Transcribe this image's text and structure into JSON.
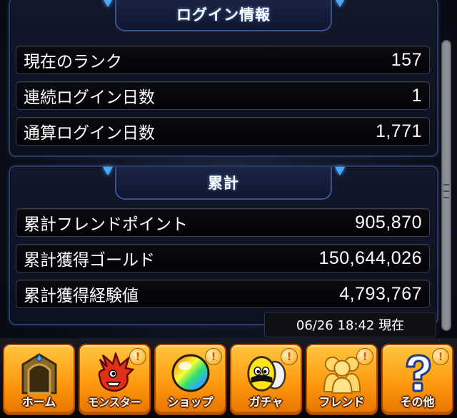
{
  "login_section": {
    "title": "ログイン情報",
    "rows": [
      {
        "label": "現在のランク",
        "value": "157"
      },
      {
        "label": "連続ログイン日数",
        "value": "1"
      },
      {
        "label": "通算ログイン日数",
        "value": "1,771"
      }
    ]
  },
  "total_section": {
    "title": "累計",
    "rows": [
      {
        "label": "累計フレンドポイント",
        "value": "905,870"
      },
      {
        "label": "累計獲得ゴールド",
        "value": "150,644,026"
      },
      {
        "label": "累計獲得経験値",
        "value": "4,793,767"
      }
    ]
  },
  "timestamp": "06/26 18:42 現在",
  "navbar": {
    "items": [
      {
        "label": "ホーム",
        "icon": "gate-icon"
      },
      {
        "label": "モンスター",
        "icon": "dragon-icon",
        "alert": "!"
      },
      {
        "label": "ショップ",
        "icon": "rainbow-orb-icon",
        "alert": "!"
      },
      {
        "label": "ガチャ",
        "icon": "egg-icon",
        "alert": "!"
      },
      {
        "label": "フレンド",
        "icon": "friends-icon",
        "alert": "!"
      },
      {
        "label": "その他",
        "icon": "question-icon",
        "alert": "!"
      }
    ]
  },
  "colors": {
    "panel_border": "#2c3c66",
    "accent_blue": "#4aa8ff",
    "nav_orange": "#ff9a10"
  }
}
